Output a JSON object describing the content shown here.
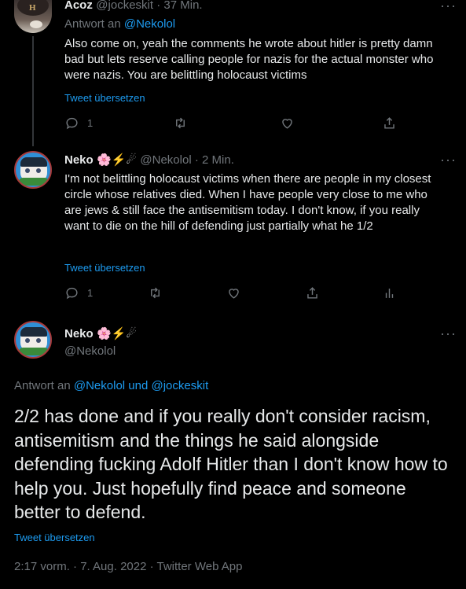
{
  "tweet1": {
    "name": "Acoz",
    "handle": "@jockeskit",
    "sep": " · ",
    "time": "37 Min.",
    "reply_prefix": "Antwort an ",
    "reply_to": "@Nekolol",
    "text": "Also come on, yeah the comments he wrote about hitler is pretty damn bad but lets reserve calling people for nazis for the actual monster who were nazis. You are belittling holocaust victims",
    "translate": "Tweet übersetzen",
    "reply_count": "1",
    "more": "···"
  },
  "tweet2": {
    "name": "Neko",
    "emojis": "🌸⚡☄",
    "handle": "@Nekolol",
    "sep": " · ",
    "time": "2 Min.",
    "text": "I'm not belittling holocaust victims when there are people in my closest circle whose relatives died. When I have people very close to me who are jews & still face the antisemitism today. I don't know, if you really want to die on the hill of defending just partially what he 1/2",
    "translate": "Tweet übersetzen",
    "reply_count": "1",
    "more": "···"
  },
  "main_tweet": {
    "name": "Neko",
    "emojis": "🌸⚡☄",
    "handle": "@Nekolol",
    "reply_prefix": "Antwort an ",
    "reply_to": "@Nekolol und @jockeskit",
    "text": "2/2 has done and if you really don't consider racism, antisemitism and the things he said alongside defending fucking Adolf Hitler than I don't know how to help you. Just hopefully find peace and someone better to defend.",
    "translate": "Tweet übersetzen",
    "timestamp": "2:17 vorm. · 7. Aug. 2022 · Twitter Web App",
    "more": "···"
  },
  "colors": {
    "background": "#000000",
    "text": "#e7e9ea",
    "muted": "#71767b",
    "accent": "#1d9bf0"
  }
}
